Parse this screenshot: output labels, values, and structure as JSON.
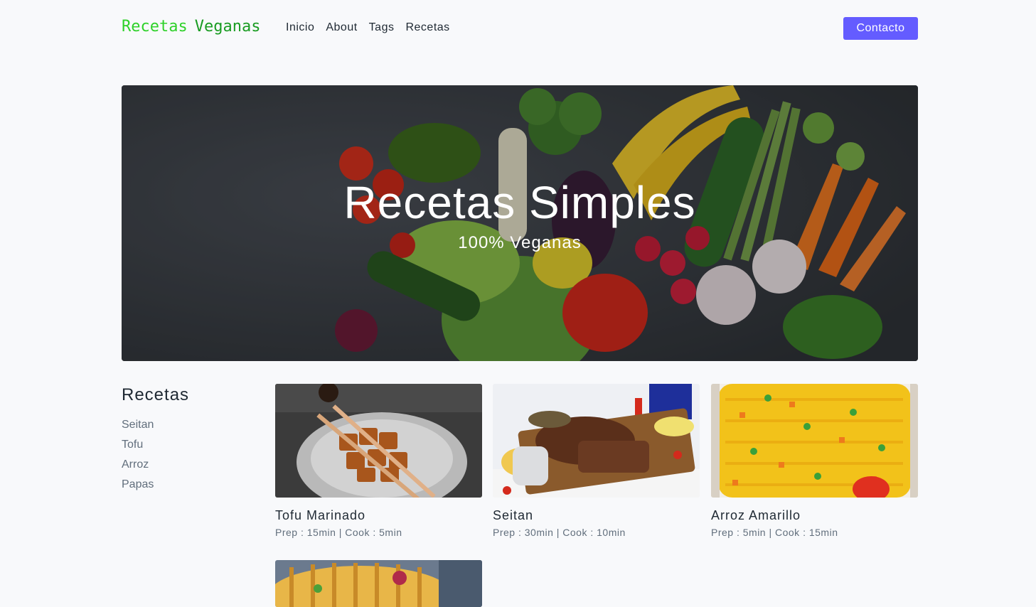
{
  "brand": {
    "part1": "Recetas",
    "part2": "Veganas"
  },
  "nav": {
    "items": [
      "Inicio",
      "About",
      "Tags",
      "Recetas"
    ],
    "contact": "Contacto"
  },
  "hero": {
    "title": "Recetas Simples",
    "subtitle": "100% Veganas"
  },
  "sidebar": {
    "title": "Recetas",
    "tags": [
      "Seitan",
      "Tofu",
      "Arroz",
      "Papas"
    ]
  },
  "recipes": [
    {
      "name": "Tofu Marinado",
      "meta": "Prep : 15min | Cook : 5min"
    },
    {
      "name": "Seitan",
      "meta": "Prep : 30min | Cook : 10min"
    },
    {
      "name": "Arroz Amarillo",
      "meta": "Prep : 5min | Cook : 15min"
    },
    {
      "name": "",
      "meta": ""
    }
  ],
  "colors": {
    "accent": "#645cff",
    "brand_light": "#2fd12a",
    "brand_dark": "#1a9c22",
    "background": "#f8f9fb"
  }
}
